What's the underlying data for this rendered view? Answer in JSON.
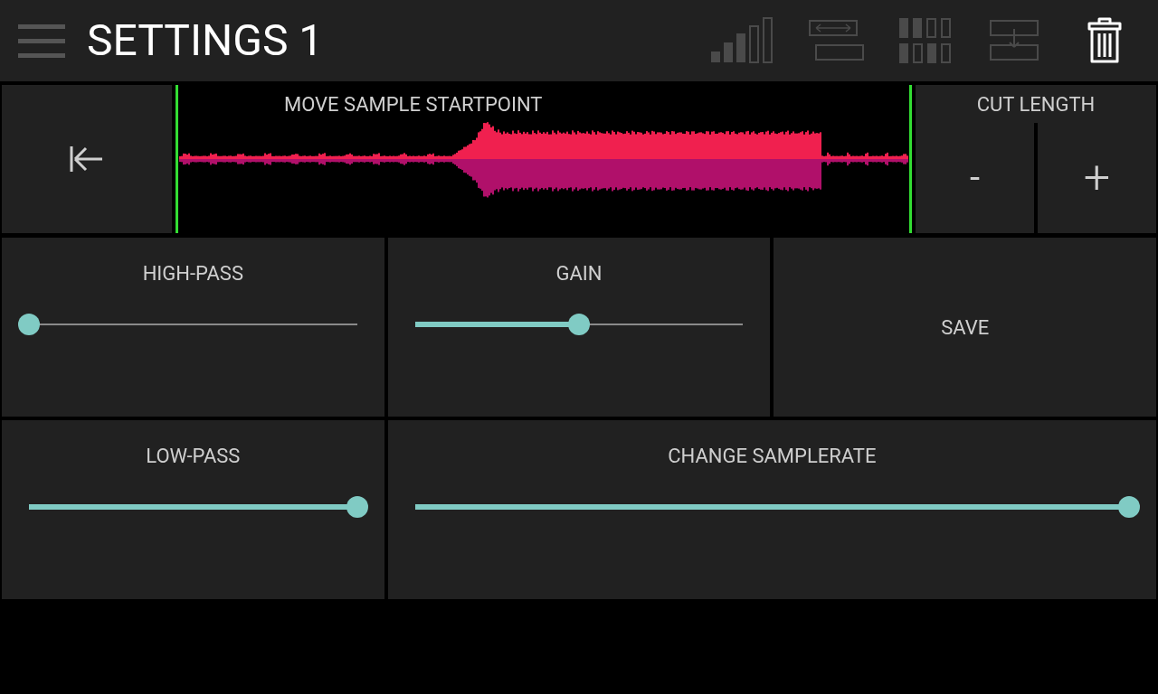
{
  "header": {
    "title": "SETTINGS 1"
  },
  "sample": {
    "title": "MOVE SAMPLE STARTPOINT",
    "cut_title": "CUT LENGTH",
    "minus": "-",
    "plus": "+"
  },
  "panels": [
    {
      "kind": "slider",
      "label": "HIGH-PASS",
      "level": 0
    },
    {
      "kind": "slider",
      "label": "GAIN",
      "level": 0.5
    },
    {
      "kind": "button",
      "label": "SAVE"
    },
    {
      "kind": "slider",
      "label": "LOW-PASS",
      "level": 1
    },
    {
      "kind": "slider",
      "label": "CHANGE SAMPLERATE",
      "level": 1
    }
  ]
}
